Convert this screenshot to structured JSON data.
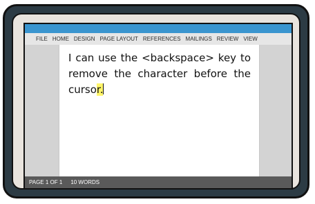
{
  "ribbon": {
    "tabs": [
      "FILE",
      "HOME",
      "DESIGN",
      "PAGE LAYOUT",
      "REFERENCES",
      "MAILINGS",
      "REVIEW",
      "VIEW"
    ]
  },
  "document": {
    "text_before_highlight": "I can use the <backspace> key to remove the character before the curso",
    "highlighted_text": "r."
  },
  "status": {
    "page": "PAGE 1 OF 1",
    "words": "10 WORDS"
  },
  "colors": {
    "screen_accent": "#3a95cf",
    "highlight": "#fff56a",
    "monitor_frame": "#2c3b44"
  }
}
